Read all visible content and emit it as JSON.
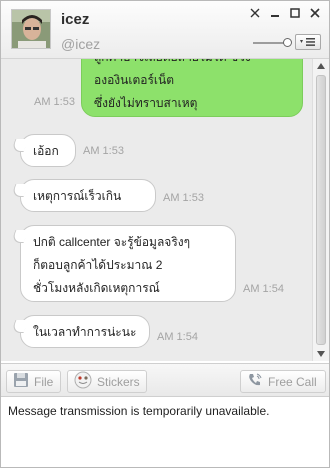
{
  "contact": {
    "name": "icez",
    "handle": "@icez"
  },
  "window_buttons": [
    "✕",
    "–",
    "□",
    "✕"
  ],
  "messages": [
    {
      "direction": "out",
      "lines": [
        "ถูกคำอาจเลยต่อสายไม่ได้ ช่วง",
        "ององินเตอร์เน็ต",
        "ซึ่งยังไม่ทราบสาเหตุ"
      ],
      "time": "AM 1:53"
    },
    {
      "direction": "in",
      "lines": [
        "เอ้อก"
      ],
      "time": "AM 1:53"
    },
    {
      "direction": "in",
      "lines": [
        "เหตุการณ์เร็วเกิน"
      ],
      "time": "AM 1:53"
    },
    {
      "direction": "in",
      "lines": [
        "ปกติ callcenter จะรู้ข้อมูลจริงๆ",
        "ก็ตอบลูกค้าได้ประมาณ 2",
        "ชั่วโมงหลังเกิดเหตุการณ์"
      ],
      "time": "AM 1:54"
    },
    {
      "direction": "in",
      "lines": [
        "ในเวลาทำการน่ะนะ"
      ],
      "time": "AM 1:54"
    }
  ],
  "toolbar": {
    "file_label": "File",
    "stickers_label": "Stickers",
    "free_call_label": "Free Call"
  },
  "input": {
    "text": "Message transmission is temporarily unavailable."
  },
  "colors": {
    "out_bubble": "#8de16b",
    "chat_bg": "#ebebeb"
  }
}
